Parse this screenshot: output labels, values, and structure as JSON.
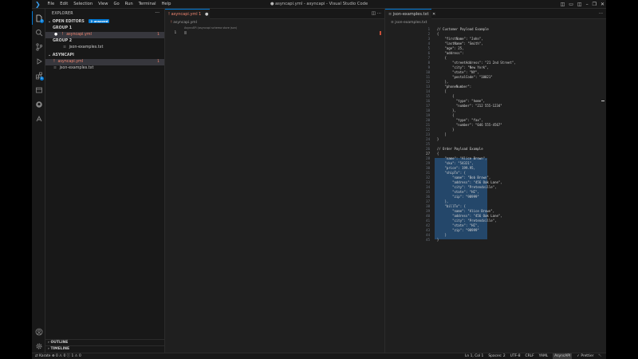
{
  "window": {
    "title": "● asyncapi.yml - asyncapi - Visual Studio Code",
    "menu": [
      "File",
      "Edit",
      "Selection",
      "View",
      "Go",
      "Run",
      "Terminal",
      "Help"
    ]
  },
  "sidebar": {
    "title": "EXPLORER",
    "open_editors": {
      "label": "OPEN EDITORS",
      "badge": "2 unsaved"
    },
    "group1": {
      "label": "GROUP 1",
      "file": "asyncapi.yml",
      "count": "1"
    },
    "group2": {
      "label": "GROUP 2",
      "file": "json-examples.txt"
    },
    "workspace": {
      "label": "ASYNCAPI",
      "files": [
        {
          "name": "asyncapi.yml",
          "count": "1"
        },
        {
          "name": "json-examples.txt"
        }
      ]
    },
    "outline": "OUTLINE",
    "timeline": "TIMELINE"
  },
  "editor1": {
    "tab": "asyncapi.yml 1",
    "breadcrumb": "asyncapi.yml",
    "hint": "AsyncAPI (asyncapi schema store json)",
    "lines": [
      {
        "n": "1",
        "text": ""
      }
    ]
  },
  "editor2": {
    "tab": "json-examples.txt",
    "breadcrumb": "json-examples.txt",
    "lines": [
      {
        "n": "1",
        "text": "  // Customer Payload Example"
      },
      {
        "n": "2",
        "text": "  {"
      },
      {
        "n": "3",
        "text": "      \"firstName\": \"John\","
      },
      {
        "n": "4",
        "text": "      \"lastName\": \"Smith\","
      },
      {
        "n": "5",
        "text": "      \"age\": 25,"
      },
      {
        "n": "6",
        "text": "      \"address\":"
      },
      {
        "n": "7",
        "text": "      {"
      },
      {
        "n": "8",
        "text": "          \"streetAddress\": \"21 2nd Street\","
      },
      {
        "n": "9",
        "text": "          \"city\": \"New York\","
      },
      {
        "n": "10",
        "text": "          \"state\": \"NY\","
      },
      {
        "n": "11",
        "text": "          \"postalCode\": \"10021\""
      },
      {
        "n": "12",
        "text": "      },"
      },
      {
        "n": "13",
        "text": "      \"phoneNumber\":"
      },
      {
        "n": "14",
        "text": "      ["
      },
      {
        "n": "15",
        "text": "          {"
      },
      {
        "n": "16",
        "text": "            \"type\": \"home\","
      },
      {
        "n": "17",
        "text": "            \"number\": \"212 555-1234\""
      },
      {
        "n": "18",
        "text": "          },"
      },
      {
        "n": "19",
        "text": "          {"
      },
      {
        "n": "20",
        "text": "            \"type\": \"fax\","
      },
      {
        "n": "21",
        "text": "            \"number\": \"646 555-4567\""
      },
      {
        "n": "22",
        "text": "          }"
      },
      {
        "n": "23",
        "text": "      ]"
      },
      {
        "n": "24",
        "text": "  }"
      },
      {
        "n": "25",
        "text": ""
      },
      {
        "n": "26",
        "text": "  // Order Payload Example"
      },
      {
        "n": "27",
        "text": "  {"
      },
      {
        "n": "28",
        "text": "      \"name\": \"Alice Brown\","
      },
      {
        "n": "29",
        "text": "      \"sku\": \"54321\","
      },
      {
        "n": "30",
        "text": "      \"price\": 199.95,"
      },
      {
        "n": "31",
        "text": "      \"shipTo\": {"
      },
      {
        "n": "32",
        "text": "          \"name\": \"Bob Brown\","
      },
      {
        "n": "33",
        "text": "          \"address\": \"456 Oak Lane\","
      },
      {
        "n": "34",
        "text": "          \"city\": \"Pretendville\","
      },
      {
        "n": "35",
        "text": "          \"state\": \"HI\","
      },
      {
        "n": "36",
        "text": "          \"zip\": \"98999\""
      },
      {
        "n": "37",
        "text": "      },"
      },
      {
        "n": "38",
        "text": "      \"billTo\": {"
      },
      {
        "n": "39",
        "text": "          \"name\": \"Alice Brown\","
      },
      {
        "n": "40",
        "text": "          \"address\": \"456 Oak Lane\","
      },
      {
        "n": "41",
        "text": "          \"city\": \"Pretendville\","
      },
      {
        "n": "42",
        "text": "          \"state\": \"HI\","
      },
      {
        "n": "43",
        "text": "          \"zip\": \"98999\""
      },
      {
        "n": "44",
        "text": "      }"
      },
      {
        "n": "45",
        "text": "  }"
      }
    ]
  },
  "status": {
    "left": "Karate  ⊗ 0 ⚠ 0   ⓘ 1 ⚠ 0",
    "right": [
      "Ln 1, Col 1",
      "Spaces: 2",
      "UTF-8",
      "CRLF",
      "YAML",
      "AsyncAPI",
      "✓ Prettier"
    ]
  },
  "colors": {
    "accent": "#0078d4",
    "error": "#f48771",
    "selection": "#264f78"
  }
}
